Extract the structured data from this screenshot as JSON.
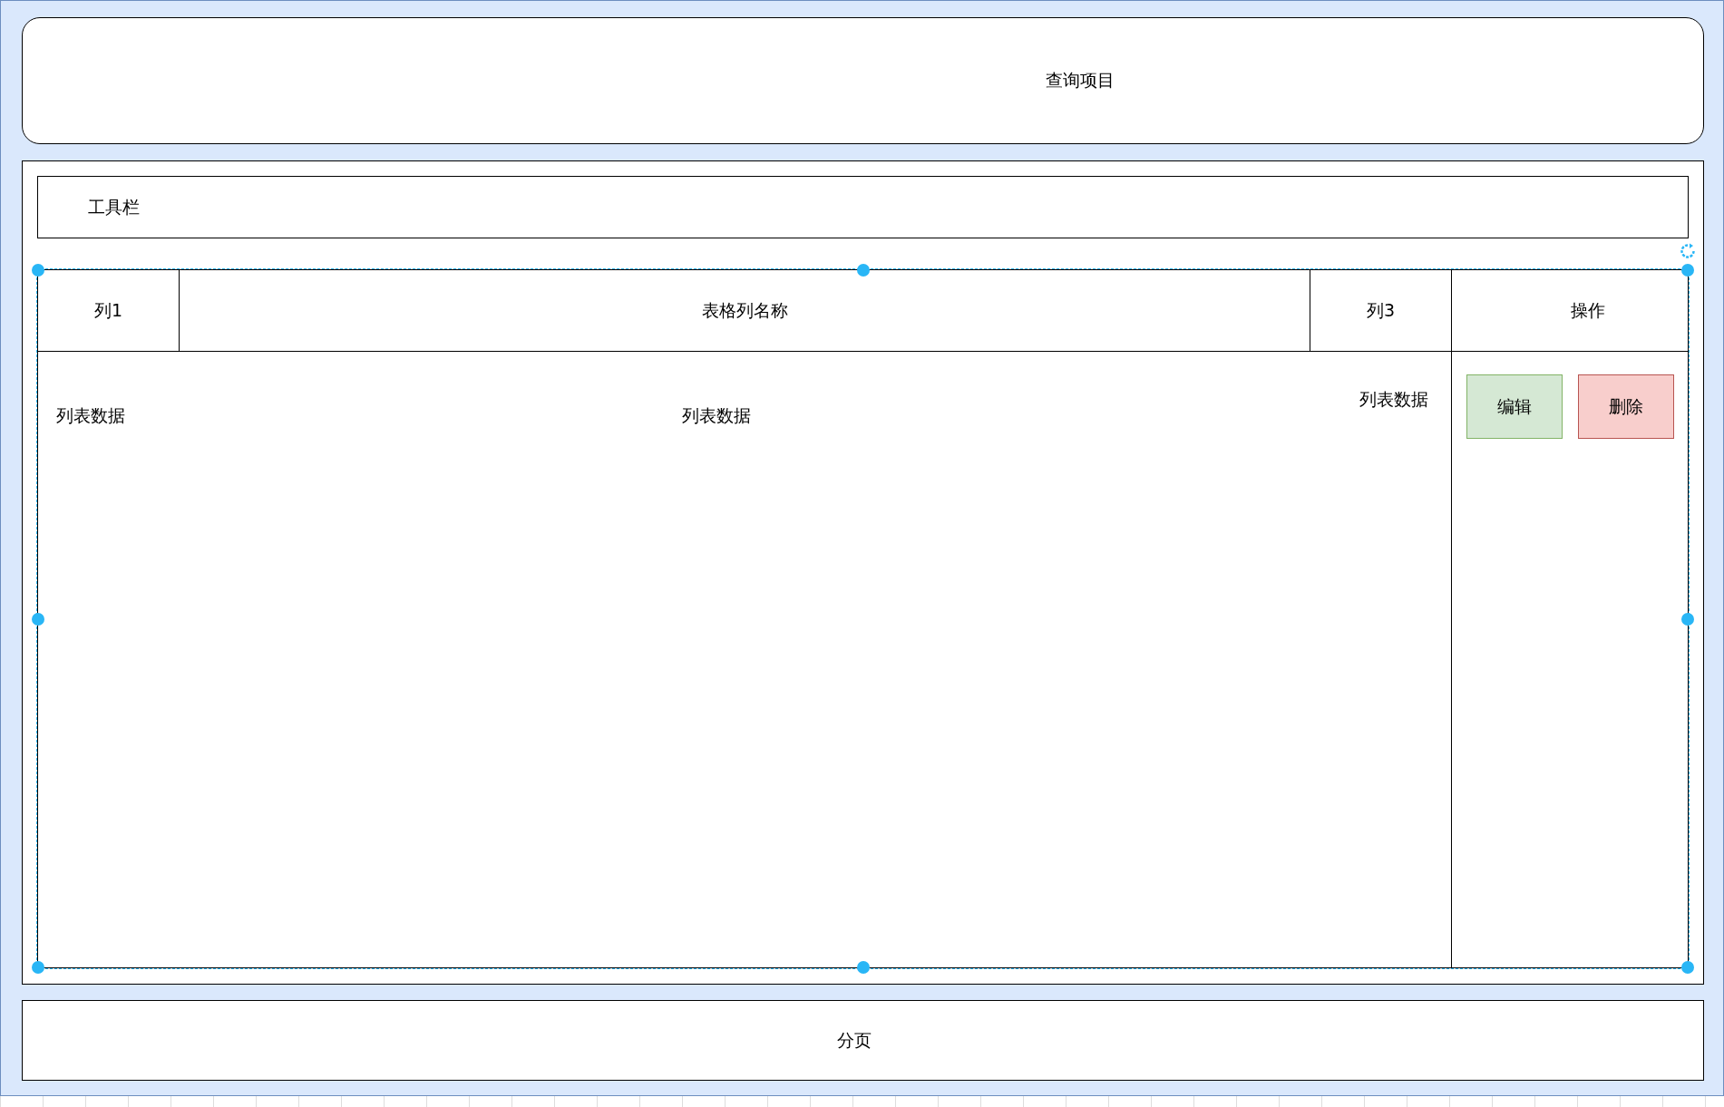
{
  "query_area": {
    "label": "查询项目"
  },
  "toolbar": {
    "label": "工具栏"
  },
  "table": {
    "columns": [
      "列1",
      "表格列名称",
      "列3",
      "操作"
    ],
    "rows": [
      {
        "cells": [
          "列表数据",
          "列表数据",
          "列表数据"
        ],
        "actions": [
          {
            "label": "编辑",
            "kind": "edit"
          },
          {
            "label": "删除",
            "kind": "delete"
          }
        ]
      }
    ]
  },
  "pagination": {
    "label": "分页"
  }
}
